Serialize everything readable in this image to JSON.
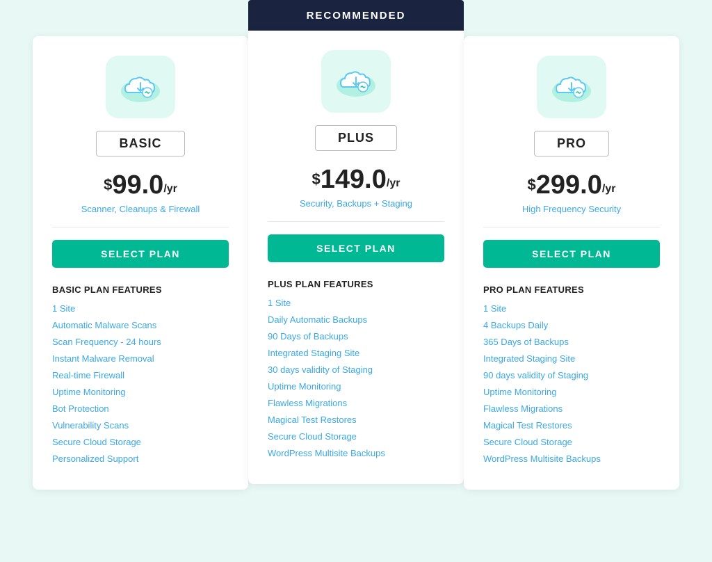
{
  "recommended_label": "RECOMMENDED",
  "plans": [
    {
      "id": "basic",
      "name": "BASIC",
      "price_dollar": "$",
      "price_amount": "99.0",
      "price_period": "/yr",
      "tagline": "Scanner, Cleanups & Firewall",
      "select_label": "SELECT PLAN",
      "features_title": "BASIC PLAN FEATURES",
      "features": [
        "1 Site",
        "Automatic Malware Scans",
        "Scan Frequency - 24 hours",
        "Instant Malware Removal",
        "Real-time Firewall",
        "Uptime Monitoring",
        "Bot Protection",
        "Vulnerability Scans",
        "Secure Cloud Storage",
        "Personalized Support"
      ]
    },
    {
      "id": "plus",
      "name": "PLUS",
      "price_dollar": "$",
      "price_amount": "149.0",
      "price_period": "/yr",
      "tagline": "Security, Backups + Staging",
      "select_label": "SELECT PLAN",
      "features_title": "PLUS PLAN FEATURES",
      "features": [
        "1 Site",
        "Daily Automatic Backups",
        "90 Days of Backups",
        "Integrated Staging Site",
        "30 days validity of Staging",
        "Uptime Monitoring",
        "Flawless Migrations",
        "Magical Test Restores",
        "Secure Cloud Storage",
        "WordPress Multisite Backups"
      ]
    },
    {
      "id": "pro",
      "name": "PRO",
      "price_dollar": "$",
      "price_amount": "299.0",
      "price_period": "/yr",
      "tagline": "High Frequency Security",
      "select_label": "SELECT PLAN",
      "features_title": "PRO PLAN FEATURES",
      "features": [
        "1 Site",
        "4 Backups Daily",
        "365 Days of Backups",
        "Integrated Staging Site",
        "90 days validity of Staging",
        "Uptime Monitoring",
        "Flawless Migrations",
        "Magical Test Restores",
        "Secure Cloud Storage",
        "WordPress Multisite Backups"
      ]
    }
  ]
}
